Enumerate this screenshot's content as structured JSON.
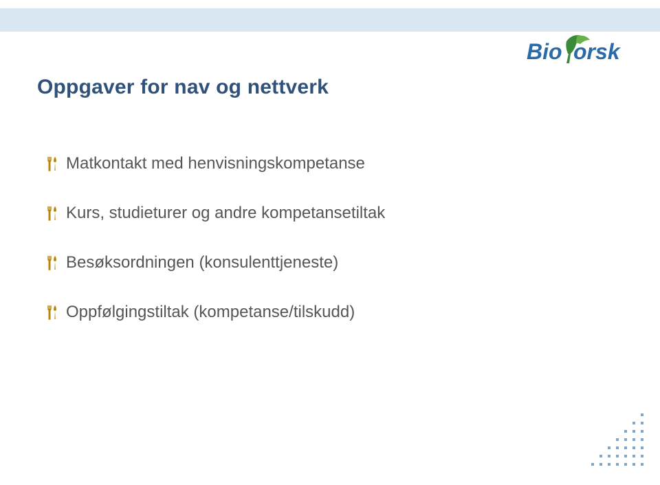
{
  "logo": {
    "name": "Bioforsk",
    "text_part1": "Bio",
    "text_part2": "orsk"
  },
  "title": "Oppgaver for nav og nettverk",
  "bullets": [
    "Matkontakt med henvisningskompetanse",
    "Kurs, studieturer og andre kompetansetiltak",
    "Besøksordningen (konsulenttjeneste)",
    "Oppfølgingstiltak (kompetanse/tilskudd)"
  ]
}
